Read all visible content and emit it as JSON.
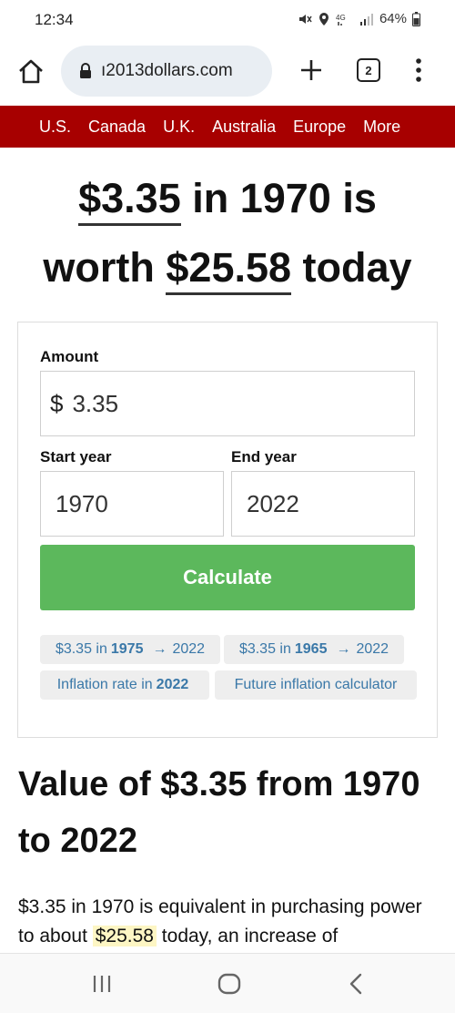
{
  "status": {
    "time": "12:34",
    "battery": "64%"
  },
  "browser": {
    "url": "ı2013dollars.com",
    "tab_count": "2"
  },
  "nav": {
    "items": [
      "U.S.",
      "Canada",
      "U.K.",
      "Australia",
      "Europe",
      "More"
    ]
  },
  "headline": {
    "amount": "$3.35",
    "mid": " in 1970 is",
    "worth": "worth ",
    "today_value": "$25.58",
    "tail": " today"
  },
  "calculator": {
    "amount_label": "Amount",
    "currency_symbol": "$",
    "amount_value": "3.35",
    "start_label": "Start year",
    "start_value": "1970",
    "end_label": "End year",
    "end_value": "2022",
    "button_label": "Calculate"
  },
  "chips": {
    "c1_pre": "$3.35 in",
    "c1_year": "1975",
    "c1_arrow": "→",
    "c1_post": "2022",
    "c2_pre": "$3.35 in",
    "c2_year": "1965",
    "c2_arrow": "→",
    "c2_post": "2022",
    "c3_pre": "Inflation rate in",
    "c3_year": "2022",
    "c4": "Future inflation calculator"
  },
  "article": {
    "title": "Value of $3.35 from 1970 to 2022",
    "text_pre": "$3.35 in 1970 is equivalent in purchasing power to about ",
    "text_highlight": "$25.58",
    "text_post": " today, an increase of"
  },
  "colors": {
    "nav_bg": "#a70000",
    "button_bg": "#5cb85c",
    "chip_text": "#3a78a8",
    "highlight": "#fdf6c4"
  }
}
